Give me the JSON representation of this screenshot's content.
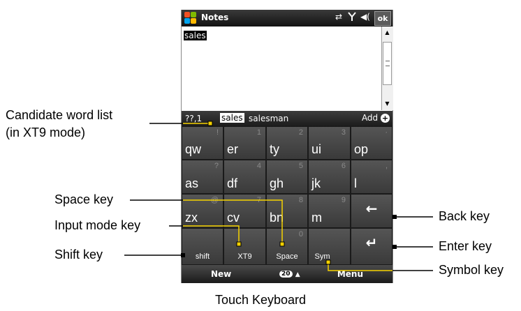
{
  "window": {
    "title": "Notes",
    "ok_label": "ok"
  },
  "status_icons": [
    "connectivity-icon",
    "signal-icon",
    "volume-icon"
  ],
  "document": {
    "text": "sales"
  },
  "candidate_bar": {
    "mode_label": "??,1",
    "candidates": [
      "sales",
      "salesman"
    ],
    "selected": "sales",
    "add_label": "Add"
  },
  "keyboard": {
    "rows": [
      [
        {
          "main": "qw",
          "alt": "!"
        },
        {
          "main": "er",
          "alt": "1"
        },
        {
          "main": "ty",
          "alt": "2"
        },
        {
          "main": "ui",
          "alt": "3"
        },
        {
          "main": "op",
          "alt": "·"
        }
      ],
      [
        {
          "main": "as",
          "alt": "?"
        },
        {
          "main": "df",
          "alt": "4"
        },
        {
          "main": "gh",
          "alt": "5"
        },
        {
          "main": "jk",
          "alt": "6"
        },
        {
          "main": "l",
          "alt": ","
        }
      ],
      [
        {
          "main": "zx",
          "alt": "@"
        },
        {
          "main": "cv",
          "alt": "7"
        },
        {
          "main": "bn",
          "alt": "8"
        },
        {
          "main": "m",
          "alt": "9"
        },
        {
          "main": "←",
          "alt": ""
        }
      ],
      [
        {
          "main": "shift",
          "alt": ""
        },
        {
          "main": "XT9",
          "alt": ""
        },
        {
          "main": "Space",
          "alt": "0"
        },
        {
          "main": "Sym",
          "alt": ""
        },
        {
          "main": "↵",
          "alt": ""
        }
      ]
    ]
  },
  "softkeys": {
    "left": "New",
    "middle_badge": "20",
    "right": "Menu"
  },
  "callouts": {
    "candidate_list_line1": "Candidate word list",
    "candidate_list_line2": "(in XT9 mode)",
    "space_key": "Space key",
    "input_mode_key": "Input mode key",
    "shift_key": "Shift key",
    "back_key": "Back key",
    "enter_key": "Enter key",
    "symbol_key": "Symbol key"
  },
  "caption": "Touch Keyboard",
  "colors": {
    "callout_line_yellow": "#f5d200",
    "key_dark": "#3a3a3a"
  }
}
